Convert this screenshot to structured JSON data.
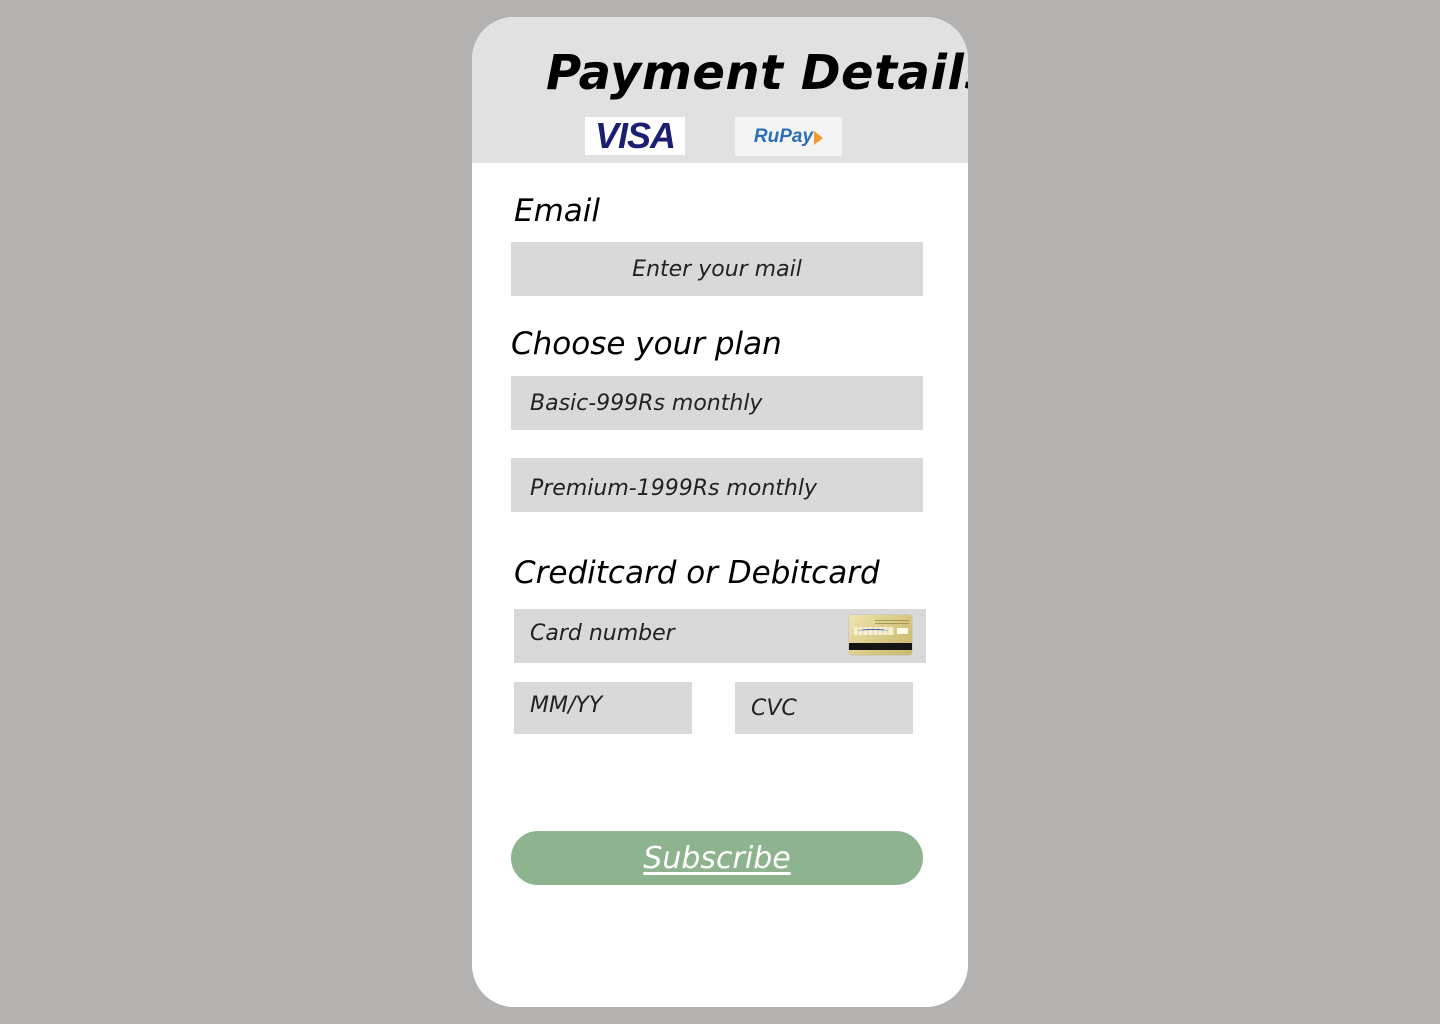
{
  "page": {
    "title": "Payment Details"
  },
  "logos": {
    "visa": "VISA",
    "rupay": "RuPay"
  },
  "email": {
    "label": "Email",
    "placeholder": "Enter your mail"
  },
  "plan": {
    "label": "Choose your plan",
    "options": [
      {
        "label": "Basic-999Rs monthly"
      },
      {
        "label": "Premium-1999Rs monthly"
      }
    ]
  },
  "card": {
    "label": "Creditcard or Debitcard",
    "number_placeholder": "Card number",
    "expiry_placeholder": "MM/YY",
    "cvc_placeholder": "CVC",
    "icon": "credit-card-icon"
  },
  "actions": {
    "subscribe_label": "Subscribe"
  },
  "colors": {
    "background": "#b3b2b0",
    "card": "#ffffff",
    "header": "#e1e1e1",
    "field": "#d9d9d9",
    "button": "#8db38f",
    "button_text": "#ffffff"
  }
}
